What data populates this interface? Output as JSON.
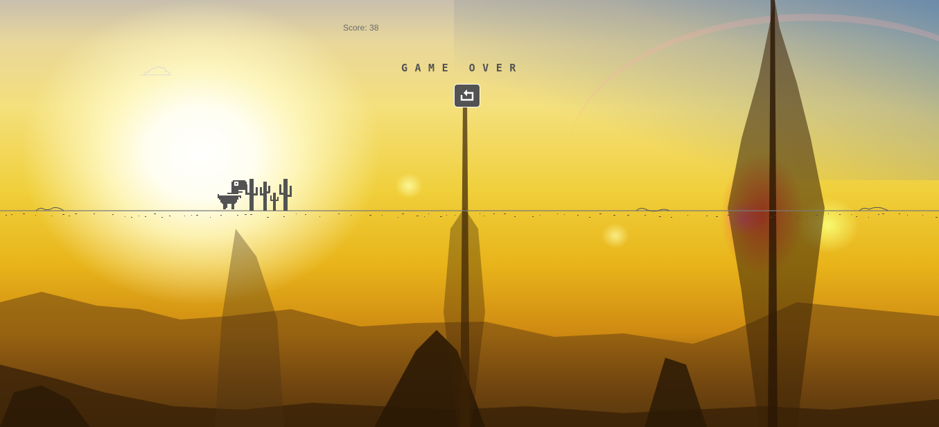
{
  "game": {
    "score_text": "Score: 38",
    "game_over_text": "GAME OVER",
    "state": "game-over"
  },
  "colors": {
    "sprite": "#535353",
    "ground_line": "#7a7a7a",
    "score_text": "#6a6a6a"
  },
  "icons": {
    "restart": "restart-arrow-icon",
    "player": "trex-dinosaur",
    "obstacle": "cactus-cluster",
    "cloud": "cloud-outline"
  }
}
